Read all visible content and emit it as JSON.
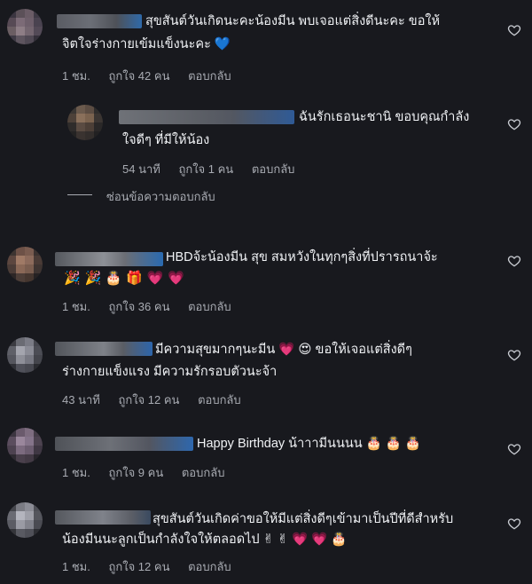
{
  "comments": [
    {
      "text1": "สุขสันต์วันเกิดนะคะน้องมีน พบเจอแต่สิ่งดีนะคะ ขอให้",
      "text2": "จิตใจร่างกายเข้มแข็งนะคะ 💙",
      "time": "1 ชม.",
      "like": "ถูกใจ 42 คน",
      "reply": "ตอบกลับ"
    },
    {
      "text1": "ฉันรักเธอนะชานิ ขอบคุณกำลัง",
      "text2": "ใจดีๆ ที่มีให้น้อง",
      "time": "54 นาที",
      "like": "ถูกใจ 1 คน",
      "reply": "ตอบกลับ"
    },
    {
      "text1": "HBDจ้ะน้องมีน สุข สมหวังในทุกๆสิ่งที่ปรารถนาจ้ะ",
      "text2": "🎉 🎉 🎂 🎁 💗 💗",
      "time": "1 ชม.",
      "like": "ถูกใจ 36 คน",
      "reply": "ตอบกลับ"
    },
    {
      "text1": "มีความสุขมากๆนะมีน 💗 😍 ขอให้เจอแต่สิ่งดีๆ",
      "text2": "ร่างกายแข็งแรง มีความรักรอบตัวนะจ้า",
      "time": "43 นาที",
      "like": "ถูกใจ 12 คน",
      "reply": "ตอบกลับ"
    },
    {
      "text1": "Happy Birthday น้าาามีนนนน 🎂 🎂 🎂",
      "time": "1 ชม.",
      "like": "ถูกใจ 9 คน",
      "reply": "ตอบกลับ"
    },
    {
      "text1": "สุขสันต์วันเกิดค่าขอให้มีแต่สิ่งดีๆเข้ามาเป็นปีที่ดีสำหรับ",
      "text2": "น้องมีนนะลูกเป็นกำลังใจให้ตลอดไป ✌ ✌ 💗 💗 🎂",
      "time": "1 ชม.",
      "like": "ถูกใจ 12 คน",
      "reply": "ตอบกลับ"
    }
  ],
  "hide_replies": "ซ่อนข้อความตอบกลับ",
  "colors": {
    "background": "#18191e",
    "text": "#f0f2f5",
    "meta": "#a8abb2",
    "name_blur_accent": "#2f69a8"
  },
  "icons": {
    "like": "heart-outline-icon"
  }
}
